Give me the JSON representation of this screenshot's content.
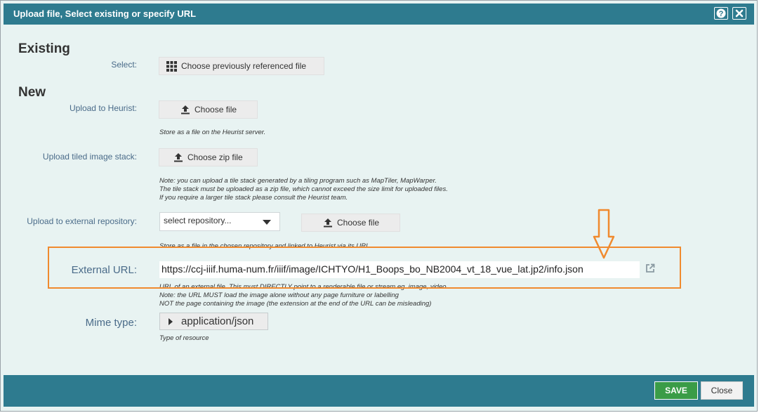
{
  "dialog": {
    "title": "Upload file, Select existing or specify URL",
    "help_label": "?",
    "close_label": "✕"
  },
  "existing": {
    "heading": "Existing",
    "select_label": "Select:",
    "choose_previous": "Choose previously referenced file"
  },
  "new": {
    "heading": "New",
    "upload_heurist_label": "Upload to Heurist:",
    "choose_file": "Choose file",
    "upload_heurist_note": "Store as a file on the Heurist server.",
    "upload_tiled_label": "Upload tiled image stack:",
    "choose_zip": "Choose zip file",
    "tiled_note_1": "Note: you can upload a tile stack generated by a tiling program such as MapTiler, MapWarper.",
    "tiled_note_2": "The tile stack must be uploaded as a zip file, which cannot exceed the size limit for uploaded files.",
    "tiled_note_3": "If you require a larger tile stack please consult the Heurist team.",
    "upload_external_label": "Upload to external repository:",
    "repository_select": "select repository...",
    "choose_file_ext": "Choose file",
    "external_repo_note": "Store as a file in the chosen repository and linked to Heurist via its URL"
  },
  "external_url": {
    "label": "External URL:",
    "value": "https://ccj-iiif.huma-num.fr/iiif/image/ICHTYO/H1_Boops_bo_NB2004_vt_18_vue_lat.jp2/info.json",
    "note_1": "URL of an external file. This must DIRECTLY point to a renderable file or stream eg. image, video.",
    "note_2": "Note: the URL MUST load the image alone without any page furniture or labelling",
    "note_3": "NOT the page containing the image (the extension at the end of the URL can be misleading)"
  },
  "mime": {
    "label": "Mime type:",
    "value": "application/json",
    "note": "Type of resource"
  },
  "footer": {
    "save": "SAVE",
    "close": "Close"
  },
  "colors": {
    "titlebar": "#2e7b8f",
    "highlight": "#f08a2e",
    "save": "#3a9c47",
    "label": "#4a6b89"
  }
}
